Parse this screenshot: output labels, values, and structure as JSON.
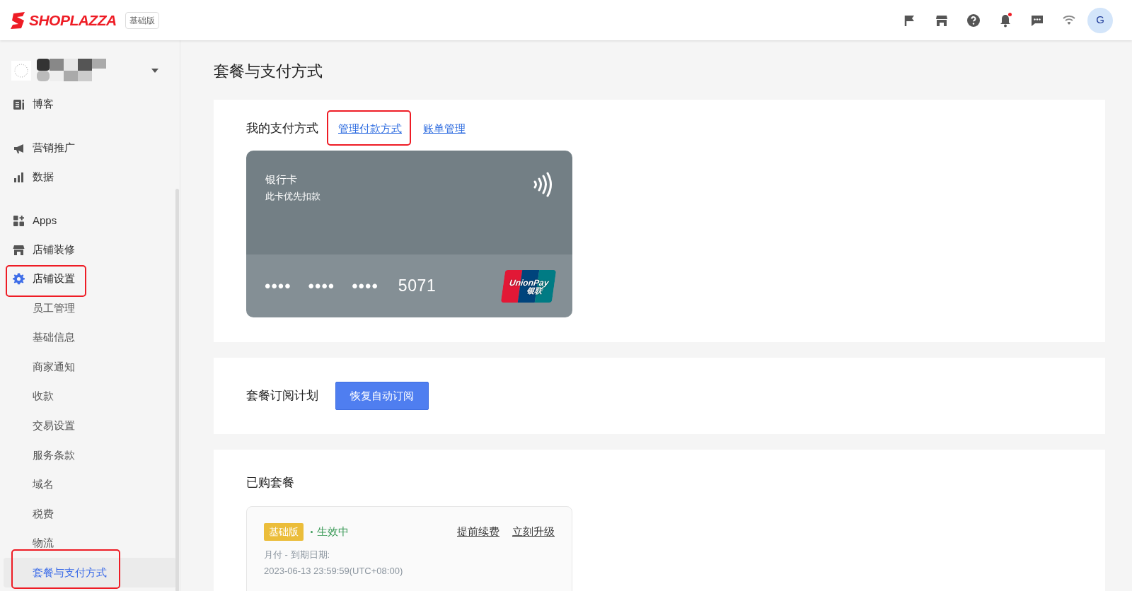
{
  "header": {
    "logo": "SHOPLAZZA",
    "plan_badge": "基础版",
    "icons": [
      {
        "kind": "flag"
      },
      {
        "kind": "store"
      },
      {
        "kind": "help"
      },
      {
        "kind": "bell",
        "badge": true
      },
      {
        "kind": "chat"
      },
      {
        "kind": "wifi"
      }
    ],
    "avatar_initial": "G"
  },
  "sidebar": {
    "groups": [
      [
        {
          "label": "博客",
          "kind": "blog",
          "selected": false
        }
      ],
      [
        {
          "label": "营销推广",
          "kind": "megaphone",
          "selected": false
        },
        {
          "label": "数据",
          "kind": "chart",
          "selected": false
        }
      ],
      [
        {
          "label": "Apps",
          "kind": "apps",
          "selected": false
        },
        {
          "label": "店铺装修",
          "kind": "store",
          "selected": false
        },
        {
          "label": "店铺设置",
          "kind": "gear",
          "selected": true,
          "highlighted": true,
          "children": [
            {
              "label": "员工管理",
              "selected": false
            },
            {
              "label": "基础信息",
              "selected": false
            },
            {
              "label": "商家通知",
              "selected": false
            },
            {
              "label": "收款",
              "selected": false
            },
            {
              "label": "交易设置",
              "selected": false
            },
            {
              "label": "服务条款",
              "selected": false
            },
            {
              "label": "域名",
              "selected": false
            },
            {
              "label": "税费",
              "selected": false
            },
            {
              "label": "物流",
              "selected": false
            },
            {
              "label": "套餐与支付方式",
              "selected": true,
              "highlighted": true
            }
          ]
        }
      ]
    ]
  },
  "page": {
    "title": "套餐与支付方式"
  },
  "payment": {
    "heading": "我的支付方式",
    "links": [
      {
        "label": "管理付款方式",
        "highlighted": true
      },
      {
        "label": "账单管理"
      }
    ],
    "card": {
      "type": "银行卡",
      "note": "此卡优先扣款",
      "masked_groups": [
        "••••",
        "••••",
        "••••"
      ],
      "last4": "5071",
      "logo_en": "UnionPay",
      "logo_cn": "银联"
    }
  },
  "subscription": {
    "label": "套餐订阅计划",
    "button": "恢复自动订阅"
  },
  "purchased": {
    "heading": "已购套餐",
    "plan": {
      "badge": "基础版",
      "status": "生效中",
      "actions": [
        "提前续费",
        "立刻升级"
      ],
      "billing": "月付 - 到期日期:",
      "expiry": "2023-06-13 23:59:59(UTC+08:00)"
    }
  }
}
